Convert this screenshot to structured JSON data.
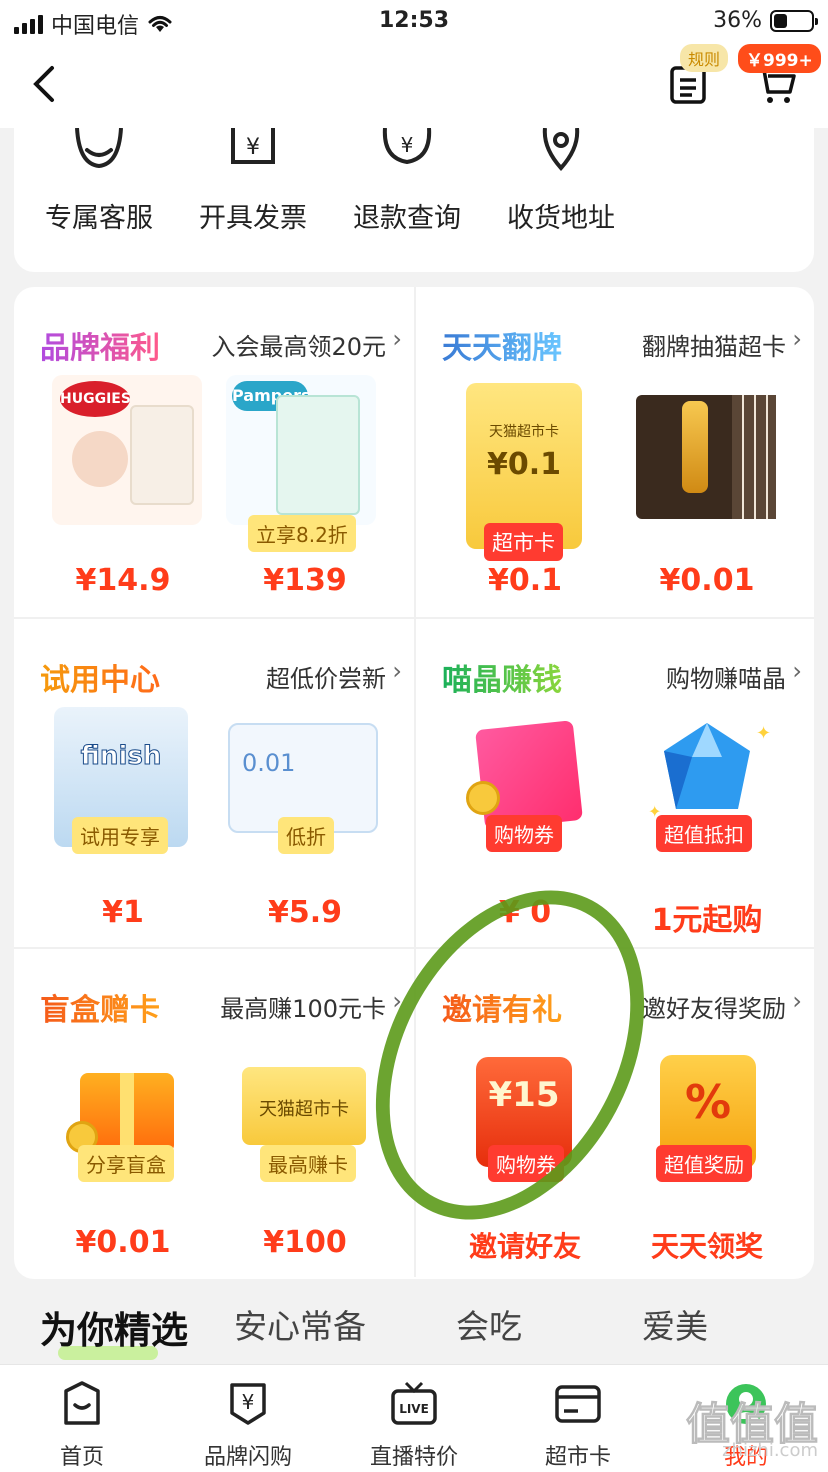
{
  "status_bar": {
    "carrier": "中国电信",
    "time": "12:53",
    "battery": "36%",
    "battery_level": 0.36
  },
  "header": {
    "badge_rules": "规则",
    "badge_cart": "￥999+"
  },
  "services": [
    {
      "label": "专属客服",
      "icon": "customer-service-icon"
    },
    {
      "label": "开具发票",
      "icon": "invoice-icon"
    },
    {
      "label": "退款查询",
      "icon": "refund-icon"
    },
    {
      "label": "收货地址",
      "icon": "location-pin-icon"
    }
  ],
  "grid": [
    {
      "title": "品牌福利",
      "title_color": "#b04be0",
      "subtitle": "入会最高领20元",
      "items": [
        {
          "brand": "HUGGIES",
          "tag": "",
          "price": "¥14.9"
        },
        {
          "brand": "Pampers",
          "tag": "立享8.2折",
          "price": "¥139"
        }
      ]
    },
    {
      "title": "天天翻牌",
      "title_color": "#3a7bd5",
      "subtitle": "翻牌抽猫超卡",
      "items": [
        {
          "card_title": "天猫超市卡",
          "card_value": "¥0.1",
          "tag": "超市卡",
          "price": "¥0.1"
        },
        {
          "tag": "",
          "price": "¥0.01"
        }
      ]
    },
    {
      "title": "试用中心",
      "title_color": "#f59a0c",
      "subtitle": "超低价尝新",
      "items": [
        {
          "brand": "finish",
          "tag": "试用专享",
          "price": "¥1"
        },
        {
          "brand": "0.01",
          "tag": "低折",
          "price": "¥5.9"
        }
      ]
    },
    {
      "title": "喵晶赚钱",
      "title_color": "#1bb05a",
      "subtitle": "购物赚喵晶",
      "items": [
        {
          "tag": "购物券",
          "price": "¥ 0"
        },
        {
          "tag": "超值抵扣",
          "price": "1元起购"
        }
      ]
    },
    {
      "title": "盲盒赠卡",
      "title_color": "#f55a1a",
      "subtitle": "最高赚100元卡",
      "items": [
        {
          "tag": "分享盲盒",
          "price": "¥0.01"
        },
        {
          "card_title": "天猫超市卡",
          "tag": "最高赚卡",
          "price": "¥100"
        }
      ]
    },
    {
      "title": "邀请有礼",
      "title_color": "#f55a1a",
      "subtitle": "邀好友得奖励",
      "items": [
        {
          "coupon": "¥15",
          "tag": "购物券",
          "price": "邀请好友"
        },
        {
          "coupon": "%",
          "tag": "超值奖励",
          "price": "天天领奖"
        }
      ]
    }
  ],
  "tabs": [
    "为你精选",
    "安心常备",
    "会吃",
    "爱美"
  ],
  "bottom_nav": [
    {
      "label": "首页",
      "icon": "home-bag-icon"
    },
    {
      "label": "品牌闪购",
      "icon": "brand-flash-icon"
    },
    {
      "label": "直播特价",
      "icon": "live-tv-icon",
      "badge": "LIVE"
    },
    {
      "label": "超市卡",
      "icon": "card-icon"
    },
    {
      "label": "我的",
      "icon": "profile-icon"
    }
  ],
  "watermark": {
    "text": "值值值",
    "sub": "zhizhi.com"
  }
}
